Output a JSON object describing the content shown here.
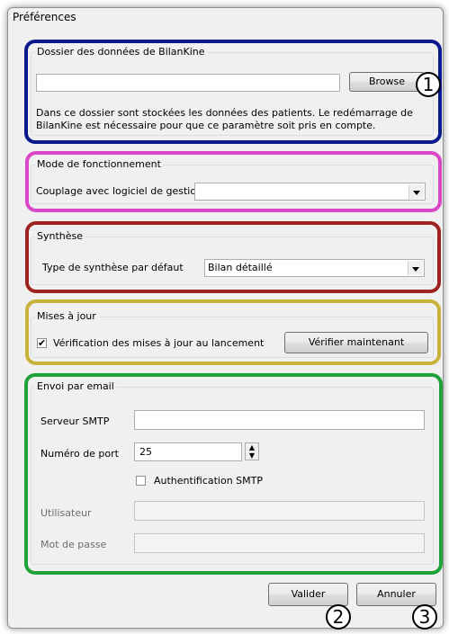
{
  "window": {
    "title": "Préférences"
  },
  "data_folder": {
    "legend": "Dossier des données de BilanKine",
    "path_value": "",
    "browse_label": "Browse",
    "description": "Dans ce dossier sont stockées les données des patients. Le redémarrage de BilanKine est nécessaire pour que ce paramètre soit pris en compte.",
    "frame_color": "#0a1a8c"
  },
  "mode": {
    "legend": "Mode de fonctionnement",
    "coupling_label": "Couplage avec logiciel de gestion",
    "coupling_value": "",
    "frame_color": "#d946c8"
  },
  "synthesis": {
    "legend": "Synthèse",
    "type_label": "Type de synthèse par défaut",
    "type_value": "Bilan détaillé",
    "frame_color": "#9e2320"
  },
  "updates": {
    "legend": "Mises à jour",
    "check_label": "Vérification des mises à jour au lancement",
    "check_checked": "✔",
    "verify_now_label": "Vérifier maintenant",
    "frame_color": "#c9b23a"
  },
  "email": {
    "legend": "Envoi par email",
    "smtp_label": "Serveur SMTP",
    "smtp_value": "",
    "port_label": "Numéro de port",
    "port_value": "25",
    "auth_label": "Authentification SMTP",
    "user_label": "Utilisateur",
    "user_value": "",
    "password_label": "Mot de passe",
    "password_value": "",
    "frame_color": "#1fa23a"
  },
  "buttons": {
    "ok_label": "Valider",
    "cancel_label": "Annuler"
  },
  "annotations": [
    "1",
    "2",
    "3"
  ]
}
